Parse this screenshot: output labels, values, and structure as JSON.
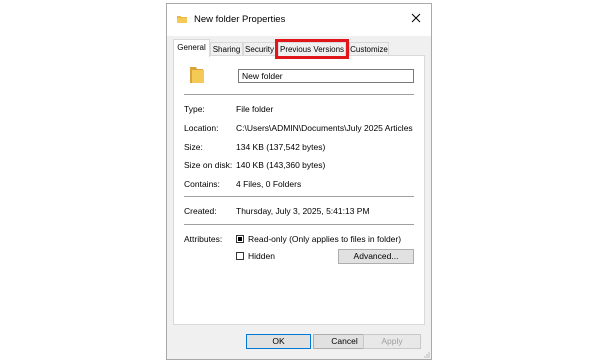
{
  "window": {
    "title": "New folder Properties",
    "title_icon": "folder-icon",
    "close_icon": "close-icon"
  },
  "tabs": [
    {
      "label": "General",
      "active": true
    },
    {
      "label": "Sharing",
      "active": false
    },
    {
      "label": "Security",
      "active": false
    },
    {
      "label": "Previous Versions",
      "active": false,
      "highlighted": true
    },
    {
      "label": "Customize",
      "active": false
    }
  ],
  "general": {
    "folder_icon": "folder-icon",
    "name_value": "New folder",
    "type_label": "Type:",
    "type_value": "File folder",
    "location_label": "Location:",
    "location_value": "C:\\Users\\ADMIN\\Documents\\July 2025 Articles",
    "size_label": "Size:",
    "size_value": "134 KB (137,542 bytes)",
    "size_on_disk_label": "Size on disk:",
    "size_on_disk_value": "140 KB (143,360 bytes)",
    "contains_label": "Contains:",
    "contains_value": "4 Files, 0 Folders",
    "created_label": "Created:",
    "created_value": "Thursday, July 3, 2025, 5:41:13 PM",
    "attributes_label": "Attributes:",
    "readonly_label": "Read-only (Only applies to files in folder)",
    "readonly_state": "indeterminate",
    "hidden_label": "Hidden",
    "hidden_state": "unchecked",
    "advanced_label": "Advanced..."
  },
  "footer": {
    "ok_label": "OK",
    "cancel_label": "Cancel",
    "apply_label": "Apply",
    "apply_enabled": false
  },
  "colors": {
    "highlight": "#e0161a",
    "folder": "#e8b84a",
    "primary_border": "#0078d7"
  }
}
